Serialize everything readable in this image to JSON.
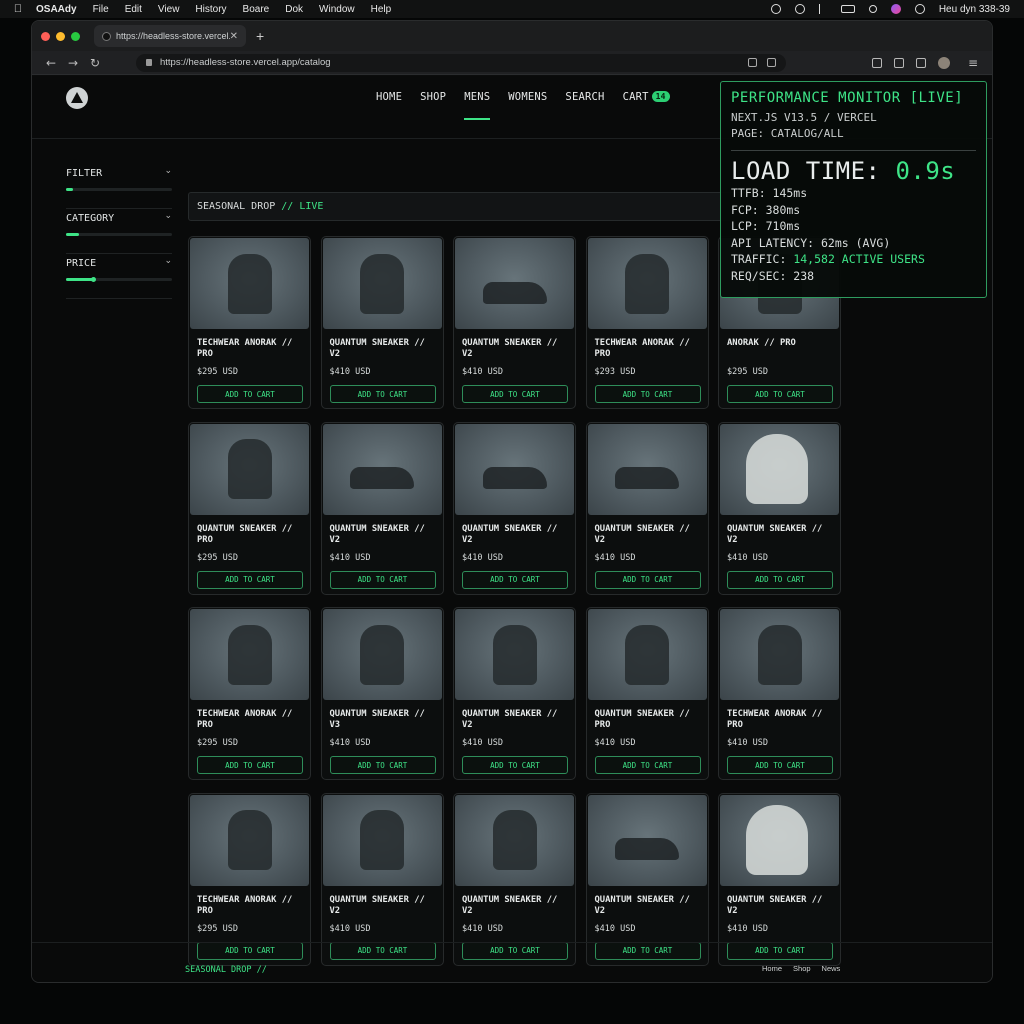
{
  "menubar": {
    "app": "OSAAdy",
    "items": [
      "File",
      "Edit",
      "View",
      "History",
      "Boare",
      "Dok",
      "Window",
      "Help"
    ],
    "clock": "Heu dyn 338-39"
  },
  "browser": {
    "tab_title": "https://headless-store.vercel.app",
    "url": "https://headless-store.vercel.app/catalog"
  },
  "site": {
    "nav": [
      "HOME",
      "SHOP",
      "MENS",
      "WOMENS",
      "SEARCH"
    ],
    "cart_label": "CART",
    "cart_count": "14",
    "active_nav": "MENS",
    "accent": "#3ee487"
  },
  "filters": [
    {
      "label": "FILTER",
      "level": 0.07
    },
    {
      "label": "CATEGORY",
      "level": 0.12
    },
    {
      "label": "PRICE",
      "level": 0.25
    }
  ],
  "dropbar": {
    "label": "SEASONAL DROP",
    "live": "// LIVE"
  },
  "button_label": "ADD TO CART",
  "products": [
    [
      "TECHWEAR ANORAK // PRO",
      "$295 USD",
      "jacket"
    ],
    [
      "QUANTUM SNEAKER // V2",
      "$410 USD",
      "jacket"
    ],
    [
      "QUANTUM SNEAKER // V2",
      "$410 USD",
      "sneaker"
    ],
    [
      "TECHWEAR ANORAK // PRO",
      "$293 USD",
      "jacket"
    ],
    [
      "ANORAK // PRO",
      "$295 USD",
      "jacket"
    ],
    [
      "QUANTUM SNEAKER // PRO",
      "$295 USD",
      "jacket"
    ],
    [
      "QUANTUM SNEAKER // V2",
      "$410 USD",
      "sneaker"
    ],
    [
      "QUANTUM SNEAKER // V2",
      "$410 USD",
      "sneaker"
    ],
    [
      "QUANTUM SNEAKER // V2",
      "$410 USD",
      "sneaker"
    ],
    [
      "QUANTUM SNEAKER // V2",
      "$410 USD",
      "light"
    ],
    [
      "TECHWEAR ANORAK // PRO",
      "$295 USD",
      "jacket"
    ],
    [
      "QUANTUM SNEAKER // V3",
      "$410 USD",
      "jacket"
    ],
    [
      "QUANTUM SNEAKER // V2",
      "$410 USD",
      "jacket"
    ],
    [
      "QUANTUM SNEAKER // PRO",
      "$410 USD",
      "jacket"
    ],
    [
      "TECHWEAR ANORAK // PRO",
      "$410 USD",
      "jacket"
    ],
    [
      "TECHWEAR ANORAK // PRO",
      "$295 USD",
      "jacket"
    ],
    [
      "QUANTUM SNEAKER // V2",
      "$410 USD",
      "jacket"
    ],
    [
      "QUANTUM SNEAKER // V2",
      "$410 USD",
      "jacket"
    ],
    [
      "QUANTUM SNEAKER // V2",
      "$410 USD",
      "sneaker"
    ],
    [
      "QUANTUM SNEAKER // V2",
      "$410 USD",
      "light"
    ]
  ],
  "perf": {
    "title": "PERFORMANCE MONITOR [LIVE]",
    "stack": "NEXT.JS V13.5 / VERCEL",
    "page": "PAGE: CATALOG/ALL",
    "load_label": "LOAD TIME:",
    "load_value": "0.9s",
    "ttfb": "TTFB: 145ms",
    "fcp": "FCP: 380ms",
    "lcp": "LCP: 710ms",
    "api": "API LATENCY: 62ms (AVG)",
    "traffic_label": "TRAFFIC:",
    "traffic_value": "14,582 ACTIVE USERS",
    "req": "REQ/SEC: 238"
  },
  "footer": {
    "brand": "SEASONAL DROP //",
    "links": [
      "Home",
      "Shop",
      "News"
    ]
  }
}
